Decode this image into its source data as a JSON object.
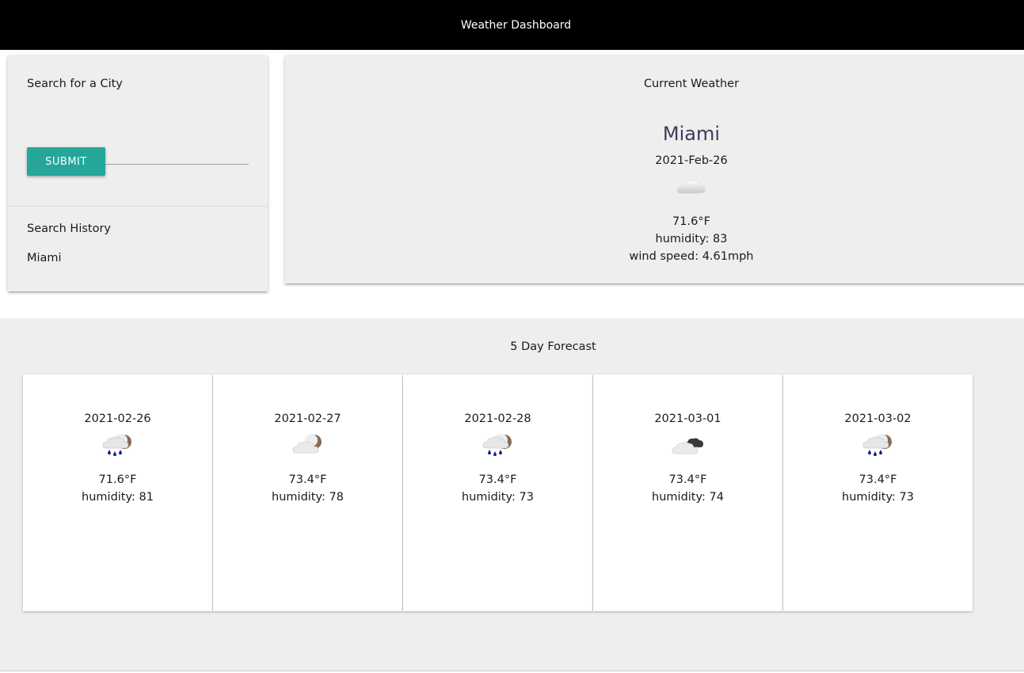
{
  "header": {
    "title": "Weather Dashboard"
  },
  "search": {
    "label": "Search for a City",
    "input_value": "",
    "submit_label": "SUBMIT",
    "history_label": "Search History",
    "history_items": [
      "Miami"
    ]
  },
  "current": {
    "heading": "Current Weather",
    "city": "Miami",
    "date": "2021-Feb-26",
    "icon": "cloud-icon",
    "temp": "71.6°F",
    "humidity": "humidity: 83",
    "wind": "wind speed: 4.61mph"
  },
  "forecast": {
    "heading": "5 Day Forecast",
    "days": [
      {
        "date": "2021-02-26",
        "icon": "rain-cloud-moon-icon",
        "temp": "71.6°F",
        "humidity": "humidity: 81"
      },
      {
        "date": "2021-02-27",
        "icon": "cloud-moon-icon",
        "temp": "73.4°F",
        "humidity": "humidity: 78"
      },
      {
        "date": "2021-02-28",
        "icon": "rain-cloud-moon-icon",
        "temp": "73.4°F",
        "humidity": "humidity: 73"
      },
      {
        "date": "2021-03-01",
        "icon": "dark-cloud-icon",
        "temp": "73.4°F",
        "humidity": "humidity: 74"
      },
      {
        "date": "2021-03-02",
        "icon": "rain-cloud-moon-icon",
        "temp": "73.4°F",
        "humidity": "humidity: 73"
      }
    ]
  },
  "colors": {
    "header_bg": "#000000",
    "accent": "#26a69a",
    "panel_bg": "#eeeeee"
  }
}
